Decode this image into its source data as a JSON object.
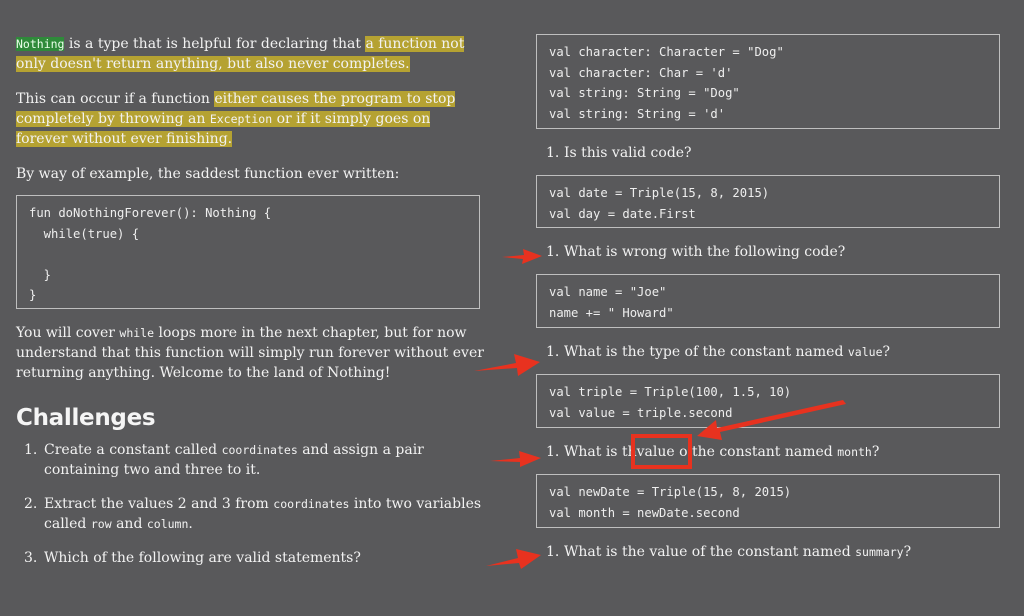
{
  "left": {
    "para1": {
      "code": "Nothing",
      "text_a": " is a type that is helpful for declaring that ",
      "hl_a": "a function not only doesn't return anything, but also never completes."
    },
    "para2": {
      "text_a": "This can occur if a function ",
      "hl_a": "either causes the program to stop completely by throwing an ",
      "hl_code": "Exception",
      "hl_b": " or if it simply goes on forever without ever finishing."
    },
    "para3": "By way of example, the saddest function ever written:",
    "code_block": "fun doNothingForever(): Nothing {\n  while(true) {\n\n  }\n}",
    "para4": {
      "text_a": "You will cover ",
      "code": "while",
      "text_b": " loops more in the next chapter, but for now understand that this function will simply run forever without ever returning anything. Welcome to the land of Nothing!"
    },
    "challenges_title": "Challenges",
    "challenges": [
      {
        "num": "1.",
        "a": "Create a constant called ",
        "code": "coordinates",
        "b": " and assign a pair containing two and three to it."
      },
      {
        "num": "2.",
        "a": "Extract the values 2 and 3 from ",
        "code": "coordinates",
        "b": " into two variables called ",
        "code2": "row",
        "c": " and ",
        "code3": "column",
        "d": "."
      },
      {
        "num": "3.",
        "a": "Which of the following are valid statements?"
      }
    ]
  },
  "right": {
    "code1": "val character: Character = \"Dog\"\nval character: Char = 'd'\nval string: String = \"Dog\"\nval string: String = 'd'",
    "q1": {
      "num": "1.",
      "text": "Is this valid code?"
    },
    "code2": "val date = Triple(15, 8, 2015)\nval day = date.First",
    "q2": {
      "num": "1.",
      "text": "What is wrong with the following code?"
    },
    "code3": "val name = \"Joe\"\nname += \" Howard\"",
    "q3": {
      "num": "1.",
      "text": "What is the type of the constant named ",
      "code": "value",
      "end": "?"
    },
    "code4": "val triple = Triple(100, 1.5, 10)\nval value = triple.second",
    "q4": {
      "num": "1.",
      "a": "What is th",
      "boxed": "value o",
      "b": " the constant named ",
      "code": "month",
      "end": "?"
    },
    "code5": "val newDate = Triple(15, 8, 2015)\nval month = newDate.second",
    "q5": {
      "num": "1.",
      "text": "What is the value of the constant named ",
      "code": "summary",
      "end": "?"
    }
  },
  "colors": {
    "background": "#59595b",
    "highlight": "#b5a232",
    "annotation_red": "#e8321f"
  }
}
